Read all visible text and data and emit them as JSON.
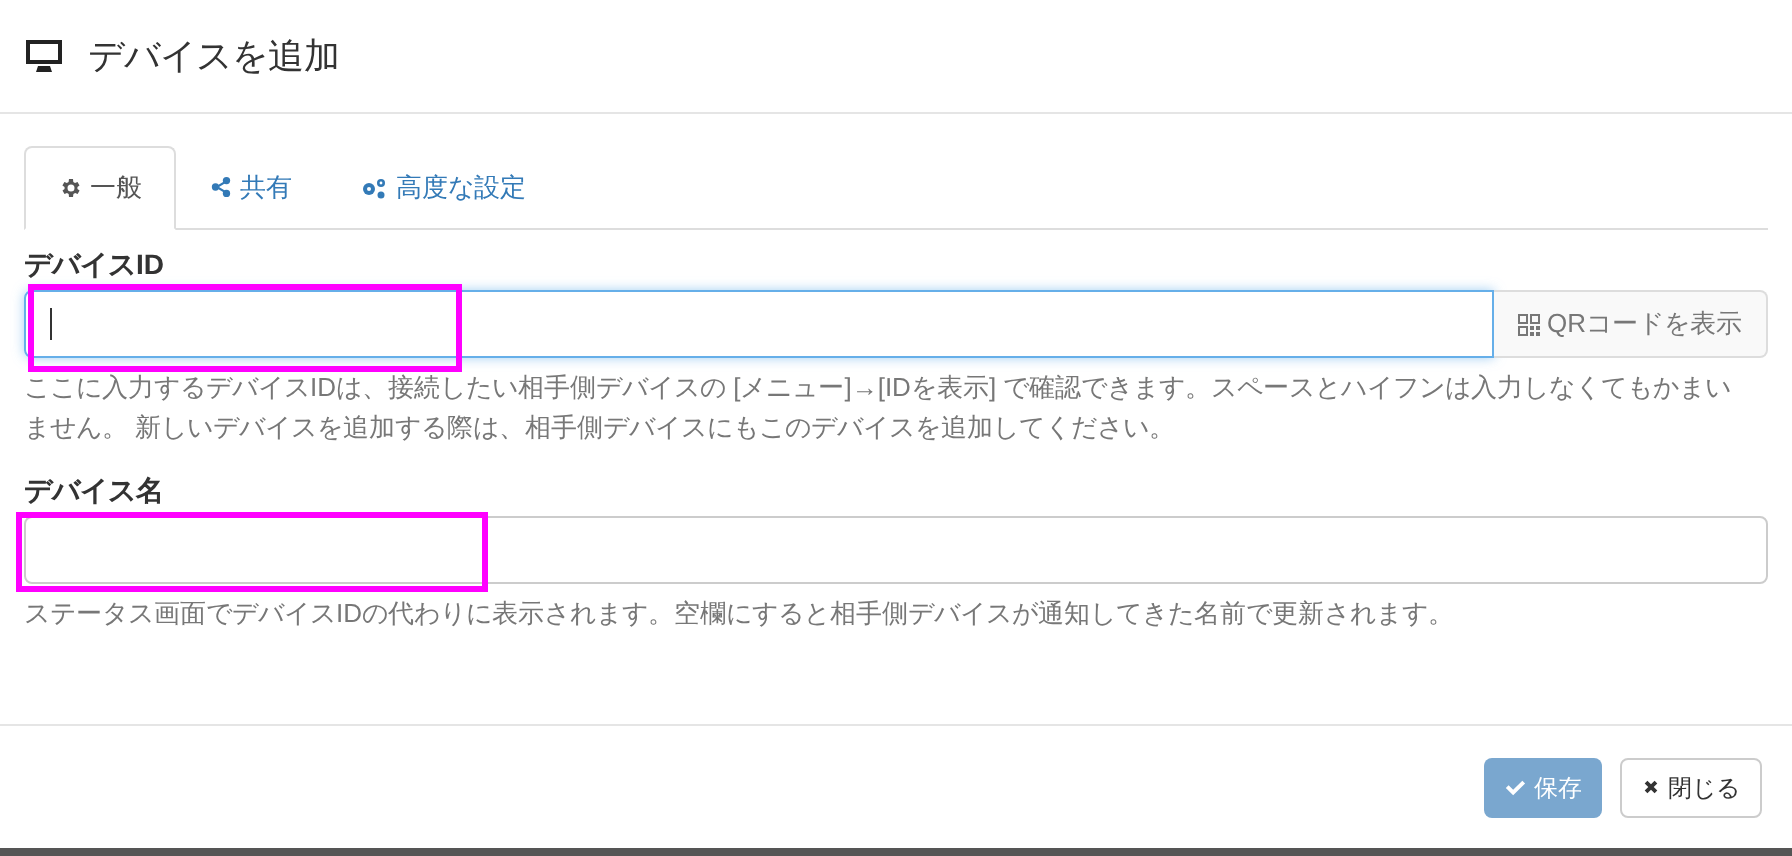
{
  "dialog": {
    "title": "デバイスを追加"
  },
  "tabs": [
    {
      "label": "一般",
      "kind": "gear",
      "selected": true
    },
    {
      "label": "共有",
      "kind": "share",
      "selected": false
    },
    {
      "label": "高度な設定",
      "kind": "gears",
      "selected": false
    }
  ],
  "fields": [
    {
      "label": "デバイスID",
      "focused": true,
      "highlighted": true,
      "addon": "QRコードを表示",
      "help": "ここに入力するデバイスIDは、接続したい相手側デバイスの [メニュー]→[IDを表示] で確認できます。スペースとハイフンは入力しなくてもかまいません。 新しいデバイスを追加する際は、相手側デバイスにもこのデバイスを追加してください。"
    },
    {
      "label": "デバイス名",
      "focused": false,
      "highlighted": true,
      "help": "ステータス画面でデバイスIDの代わりに表示されます。空欄にすると相手側デバイスが通知してきた名前で更新されます。"
    }
  ],
  "buttons": [
    {
      "label": "保存",
      "kind": "save",
      "disabled": true
    },
    {
      "label": "閉じる",
      "kind": "close",
      "disabled": false
    }
  ]
}
